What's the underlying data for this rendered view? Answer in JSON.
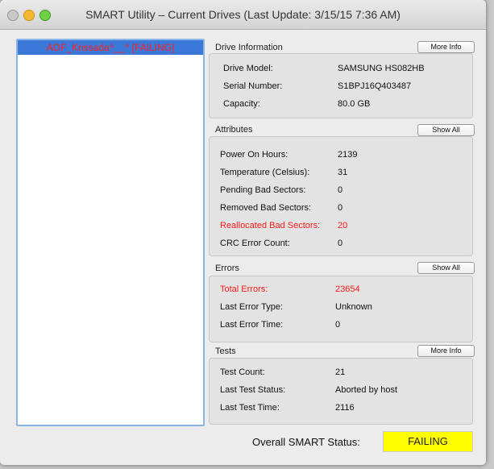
{
  "window": {
    "title": "SMART Utility – Current Drives (Last Update: 3/15/15 7:36 AM)"
  },
  "drives": [
    {
      "label": "AOF_Krissada^__^  [FAILING]"
    }
  ],
  "drive_info": {
    "title": "Drive Information",
    "button": "More Info",
    "rows": [
      {
        "label": "Drive Model:",
        "value": "SAMSUNG HS082HB"
      },
      {
        "label": "Serial Number:",
        "value": "S1BPJ16Q403487"
      },
      {
        "label": "Capacity:",
        "value": "80.0 GB"
      }
    ]
  },
  "attributes": {
    "title": "Attributes",
    "button": "Show All",
    "rows": [
      {
        "label": "Power On Hours:",
        "value": "2139"
      },
      {
        "label": "Temperature (Celsius):",
        "value": "31"
      },
      {
        "label": "Pending Bad Sectors:",
        "value": "0"
      },
      {
        "label": "Removed Bad Sectors:",
        "value": "0"
      },
      {
        "label": "Reallocated Bad Sectors:",
        "value": "20"
      },
      {
        "label": "CRC Error Count:",
        "value": "0"
      }
    ]
  },
  "errors": {
    "title": "Errors",
    "button": "Show All",
    "rows": [
      {
        "label": "Total Errors:",
        "value": "23654"
      },
      {
        "label": "Last Error Type:",
        "value": "Unknown"
      },
      {
        "label": "Last Error Time:",
        "value": "0"
      }
    ]
  },
  "tests": {
    "title": "Tests",
    "button": "More Info",
    "rows": [
      {
        "label": "Test Count:",
        "value": "21"
      },
      {
        "label": "Last Test Status:",
        "value": "Aborted by host"
      },
      {
        "label": "Last Test Time:",
        "value": "2116"
      }
    ]
  },
  "overall": {
    "label": "Overall SMART Status:",
    "value": "FAILING",
    "color": "#ffff00"
  },
  "colors": {
    "failing_text": "#ff1a1a",
    "selection": "#3b78d8"
  }
}
